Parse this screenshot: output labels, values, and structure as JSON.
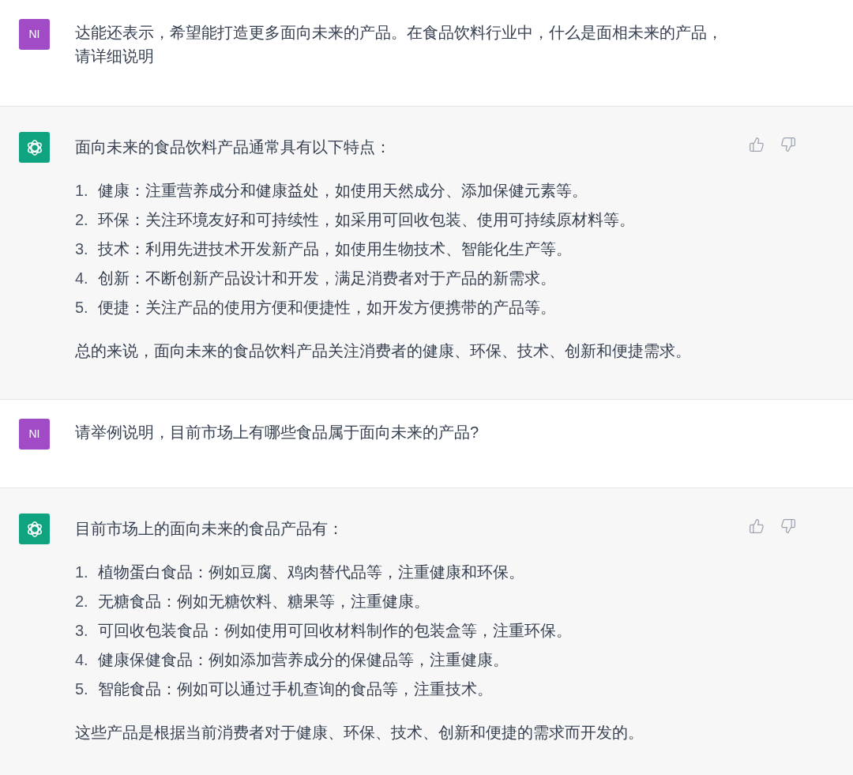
{
  "messages": [
    {
      "kind": "user",
      "avatar": "NI",
      "text": "达能还表示，希望能打造更多面向未来的产品。在食品饮料行业中，什么是面相未来的产品，请详细说明"
    },
    {
      "kind": "assistant",
      "intro": "面向未来的食品饮料产品通常具有以下特点：",
      "items": [
        {
          "number": "1.",
          "text": "健康：注重营养成分和健康益处，如使用天然成分、添加保健元素等。"
        },
        {
          "number": "2.",
          "text": "环保：关注环境友好和可持续性，如采用可回收包装、使用可持续原材料等。"
        },
        {
          "number": "3.",
          "text": "技术：利用先进技术开发新产品，如使用生物技术、智能化生产等。"
        },
        {
          "number": "4.",
          "text": "创新：不断创新产品设计和开发，满足消费者对于产品的新需求。"
        },
        {
          "number": "5.",
          "text": "便捷：关注产品的使用方便和便捷性，如开发方便携带的产品等。"
        }
      ],
      "conclusion": "总的来说，面向未来的食品饮料产品关注消费者的健康、环保、技术、创新和便捷需求。"
    },
    {
      "kind": "user",
      "avatar": "NI",
      "text": "请举例说明，目前市场上有哪些食品属于面向未来的产品?"
    },
    {
      "kind": "assistant",
      "intro": "目前市场上的面向未来的食品产品有：",
      "items": [
        {
          "number": "1.",
          "text": "植物蛋白食品：例如豆腐、鸡肉替代品等，注重健康和环保。"
        },
        {
          "number": "2.",
          "text": "无糖食品：例如无糖饮料、糖果等，注重健康。"
        },
        {
          "number": "3.",
          "text": "可回收包装食品：例如使用可回收材料制作的包装盒等，注重环保。"
        },
        {
          "number": "4.",
          "text": "健康保健食品：例如添加营养成分的保健品等，注重健康。"
        },
        {
          "number": "5.",
          "text": "智能食品：例如可以通过手机查询的食品等，注重技术。"
        }
      ],
      "conclusion": "这些产品是根据当前消费者对于健康、环保、技术、创新和便捷的需求而开发的。"
    }
  ]
}
